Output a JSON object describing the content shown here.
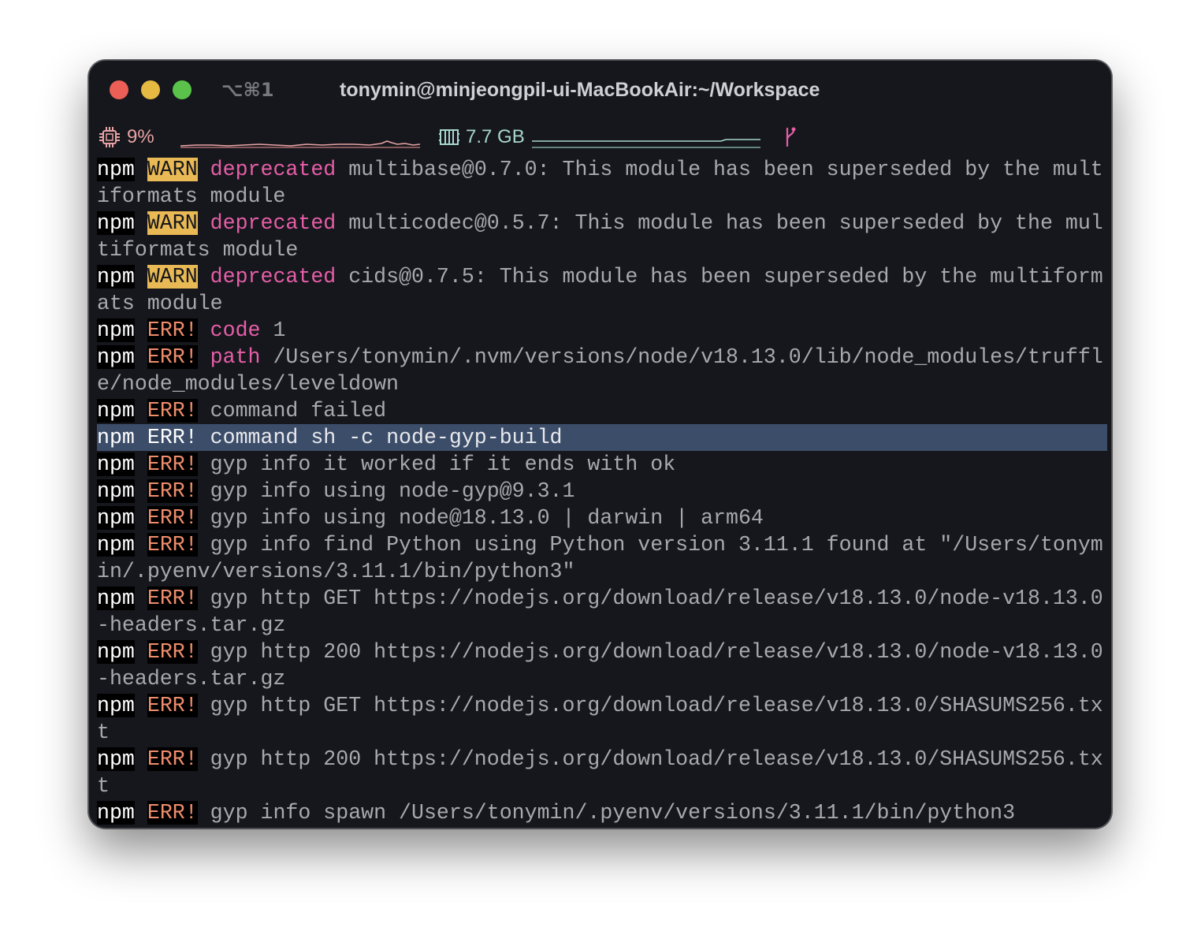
{
  "window": {
    "title": "tonymin@minjeongpil-ui-MacBookAir:~/Workspace",
    "shortcut": "⌥⌘1",
    "colors": {
      "background": "#16171c",
      "close": "#ec5f57",
      "minimize": "#e6b942",
      "maximize": "#5ac24a"
    }
  },
  "status": {
    "cpu_label": "9%",
    "mem_label": "7.7 GB",
    "cpu_icon": "cpu-chip-icon",
    "mem_icon": "memory-icon",
    "git_icon": "git-branch-icon",
    "colors": {
      "cpu": "#e8a3a5",
      "mem": "#a6d6cf",
      "git": "#e65ea8"
    }
  },
  "terminal": {
    "colors": {
      "text": "#a8a9ac",
      "warn_badge": "#e8b954",
      "err": "#ef8d6c",
      "keyword": "#e65ea8",
      "selection": "#3c4d6a"
    },
    "lines": [
      {
        "npm": "npm",
        "warn": "WARN",
        "keyword": "deprecated",
        "text": " multibase@0.7.0: This module has been superseded by the mult"
      },
      {
        "text": "iformats module"
      },
      {
        "npm": "npm",
        "warn": "WARN",
        "keyword": "deprecated",
        "text": " multicodec@0.5.7: This module has been superseded by the mul"
      },
      {
        "text": "tiformats module"
      },
      {
        "npm": "npm",
        "warn": "WARN",
        "keyword": "deprecated",
        "text": " cids@0.7.5: This module has been superseded by the multiform"
      },
      {
        "text": "ats module"
      },
      {
        "npm": "npm",
        "err": "ERR!",
        "keyword": "code",
        "text": " 1"
      },
      {
        "npm": "npm",
        "err": "ERR!",
        "keyword": "path",
        "text": " /Users/tonymin/.nvm/versions/node/v18.13.0/lib/node_modules/truffl"
      },
      {
        "text": "e/node_modules/leveldown"
      },
      {
        "npm": "npm",
        "err": "ERR!",
        "text": "command failed"
      },
      {
        "npm": "npm",
        "err": "ERR!",
        "text": "command sh -c node-gyp-build",
        "selected": true
      },
      {
        "npm": "npm",
        "err": "ERR!",
        "text": "gyp info it worked if it ends with ok"
      },
      {
        "npm": "npm",
        "err": "ERR!",
        "text": "gyp info using node-gyp@9.3.1"
      },
      {
        "npm": "npm",
        "err": "ERR!",
        "text": "gyp info using node@18.13.0 | darwin | arm64"
      },
      {
        "npm": "npm",
        "err": "ERR!",
        "text": "gyp info find Python using Python version 3.11.1 found at \"/Users/tonym"
      },
      {
        "text": "in/.pyenv/versions/3.11.1/bin/python3\""
      },
      {
        "npm": "npm",
        "err": "ERR!",
        "text": "gyp http GET https://nodejs.org/download/release/v18.13.0/node-v18.13.0"
      },
      {
        "text": "-headers.tar.gz"
      },
      {
        "npm": "npm",
        "err": "ERR!",
        "text": "gyp http 200 https://nodejs.org/download/release/v18.13.0/node-v18.13.0"
      },
      {
        "text": "-headers.tar.gz"
      },
      {
        "npm": "npm",
        "err": "ERR!",
        "text": "gyp http GET https://nodejs.org/download/release/v18.13.0/SHASUMS256.tx"
      },
      {
        "text": "t"
      },
      {
        "npm": "npm",
        "err": "ERR!",
        "text": "gyp http 200 https://nodejs.org/download/release/v18.13.0/SHASUMS256.tx"
      },
      {
        "text": "t"
      },
      {
        "npm": "npm",
        "err": "ERR!",
        "text": "gyp info spawn /Users/tonymin/.pyenv/versions/3.11.1/bin/python3"
      }
    ]
  }
}
